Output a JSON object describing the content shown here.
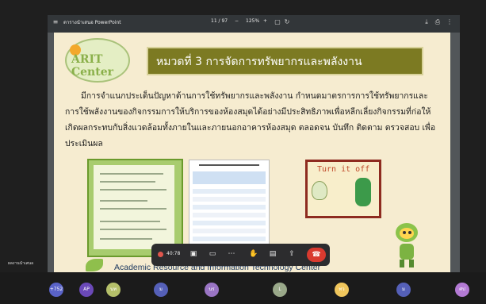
{
  "pdf_viewer": {
    "filename": "ตารางนำเสนอ PowerPoint",
    "page_indicator": "11 / 97",
    "zoom": "125%",
    "minus": "−",
    "plus": "+"
  },
  "slide": {
    "logo_text": "ARIT Center",
    "title": "หมวดที่ 3 การจัดการทรัพยากรและพลังงาน",
    "body": "มีการจำแนกประเด็นปัญหาด้านการใช้ทรัพยากรและพลังงาน กำหนดมาตรการการใช้ทรัพยากรและการใช้พลังงานของกิจกรรมการให้บริการของห้องสมุดได้อย่างมีประสิทธิภาพเพื่อหลีกเลี่ยงกิจกรรมที่ก่อให้เกิดผลกระทบกับสิ่งแวดล้อมทั้งภายในและภายนอกอาคารห้องสมุด ตลอดจน บันทึก ติดตาม ตรวจสอบ เพื่อประเมินผล",
    "turnoff_title": "Turn it off",
    "footer": "Academic Resource and Information Technology Center"
  },
  "meet": {
    "rec_time": "40:78",
    "presenter_label": "ผลงานนำเสนอ"
  },
  "participants": [
    {
      "initials": "+752",
      "color": "#5a63c8"
    },
    {
      "initials": "AP",
      "color": "#6b49b8"
    },
    {
      "initials": "นท",
      "color": "#b5c06a"
    },
    {
      "initials": "ม",
      "color": "#5560b8"
    },
    {
      "initials": "นร",
      "color": "#9a75c4"
    },
    {
      "initials": "L",
      "color": "#9aa98a"
    },
    {
      "initials": "ทว",
      "color": "#f0c65c"
    },
    {
      "initials": "ม",
      "color": "#5560b8"
    },
    {
      "initials": "ศป",
      "color": "#b37ad4"
    }
  ]
}
